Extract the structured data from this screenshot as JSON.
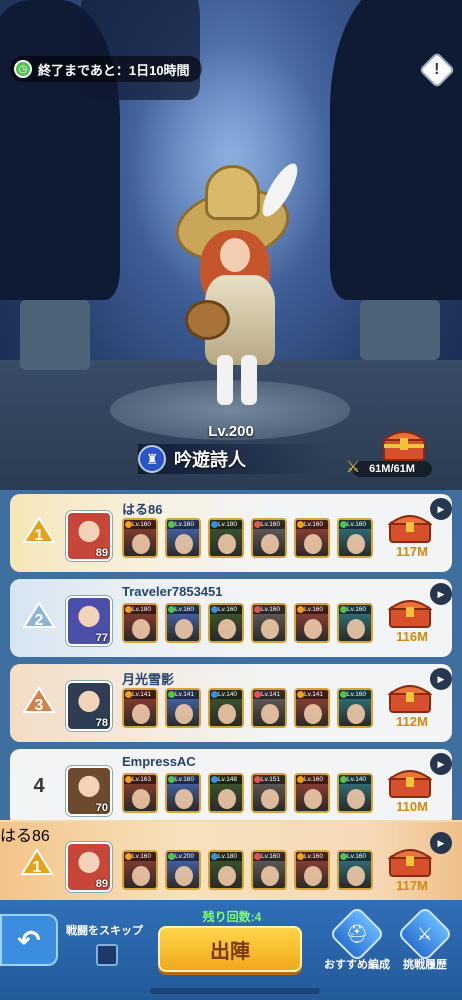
{
  "event": {
    "timer_label": "終了まであと：1日10時間"
  },
  "hero": {
    "level": "Lv.200",
    "class_name": "吟遊詩人",
    "power": "61M/61M"
  },
  "rankings": [
    {
      "rank": "1",
      "player": "はる86",
      "avatar_level": "89",
      "power": "117M",
      "heroes": [
        "Lv.160",
        "Lv.160",
        "Lv.180",
        "Lv.160",
        "Lv.160",
        "Lv.160"
      ]
    },
    {
      "rank": "2",
      "player": "Traveler7853451",
      "avatar_level": "77",
      "power": "116M",
      "heroes": [
        "Lv.180",
        "Lv.160",
        "Lv.160",
        "Lv.160",
        "Lv.160",
        "Lv.160"
      ]
    },
    {
      "rank": "3",
      "player": "月光雪影",
      "avatar_level": "78",
      "power": "112M",
      "heroes": [
        "Lv.141",
        "Lv.141",
        "Lv.140",
        "Lv.141",
        "Lv.141",
        "Lv.160"
      ]
    },
    {
      "rank": "4",
      "player": "EmpressAC",
      "avatar_level": "70",
      "power": "110M",
      "heroes": [
        "Lv.163",
        "Lv.160",
        "Lv.148",
        "Lv.151",
        "Lv.160",
        "Lv.140"
      ]
    }
  ],
  "my_rank": {
    "rank": "1",
    "player": "はる86",
    "avatar_level": "89",
    "power": "117M",
    "heroes": [
      "Lv.160",
      "Lv.200",
      "Lv.180",
      "Lv.160",
      "Lv.160",
      "Lv.160"
    ]
  },
  "bottom": {
    "skip_battle": "戦闘をスキップ",
    "remaining": "残り回数:4",
    "sortie": "出陣",
    "recommended": "おすすめ編成",
    "history": "挑戦履歴"
  },
  "colors": {
    "gold": "#d28b0f",
    "accent_blue": "#2f6fb8",
    "sortie_yellow": "#ffd54a",
    "remaining_green": "#7dff6e"
  }
}
